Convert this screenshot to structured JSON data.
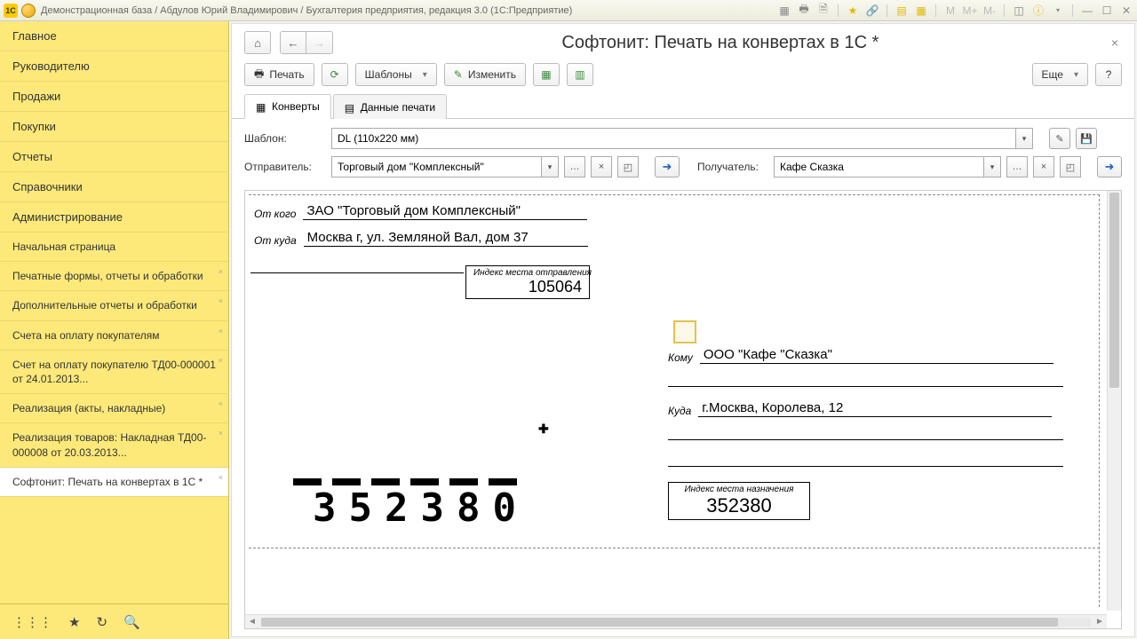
{
  "titlebar": {
    "text": "Демонстрационная база / Абдулов Юрий Владимирович / Бухгалтерия предприятия, редакция 3.0  (1С:Предприятие)",
    "logo": "1C"
  },
  "sidebar": {
    "items": [
      "Главное",
      "Руководителю",
      "Продажи",
      "Покупки",
      "Отчеты",
      "Справочники",
      "Администрирование",
      "Начальная страница",
      "Печатные формы, отчеты и обработки",
      "Дополнительные отчеты и обработки",
      "Счета на оплату покупателям",
      "Счет на оплату покупателю ТД00-000001 от 24.01.2013...",
      "Реализация (акты, накладные)",
      "Реализация товаров: Накладная ТД00-000008 от 20.03.2013...",
      "Софтонит: Печать на конвертах в 1С *"
    ]
  },
  "page": {
    "title": "Софтонит: Печать на конвертах в 1С *"
  },
  "toolbar": {
    "print": "Печать",
    "templates": "Шаблоны",
    "edit": "Изменить",
    "more": "Еще"
  },
  "tabs": {
    "envelopes": "Конверты",
    "printdata": "Данные печати"
  },
  "form": {
    "template_label": "Шаблон:",
    "template_value": "DL (110x220 мм)",
    "sender_label": "Отправитель:",
    "sender_value": "Торговый дом \"Комплексный\"",
    "recipient_label": "Получатель:",
    "recipient_value": "Кафе Сказка"
  },
  "envelope": {
    "from_label": "От кого",
    "from_value": "ЗАО \"Торговый дом Комплексный\"",
    "fromaddr_label": "От куда",
    "fromaddr_value": "Москва г, ул. Земляной Вал, дом 37",
    "sender_index_label": "Индекс места отправления",
    "sender_index": "105064",
    "to_label": "Кому",
    "to_value": "ООО \"Кафе \"Сказка\"",
    "toaddr_label": "Куда",
    "toaddr_value": "г.Москва, Королева, 12",
    "dest_index_label": "Индекс места назначения",
    "dest_index": "352380",
    "postal_code": "352380"
  }
}
